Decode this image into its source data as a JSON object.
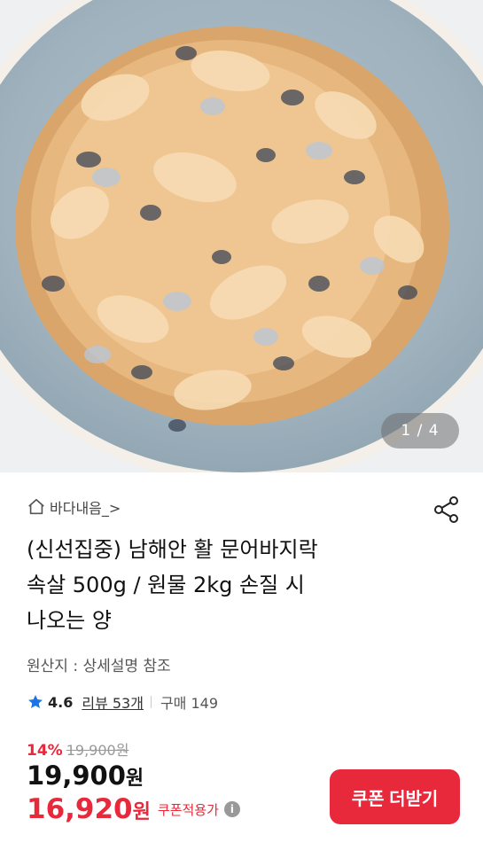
{
  "image": {
    "pager": "1 / 4",
    "icon": "product-photo-clams"
  },
  "store": {
    "name": "바다내음_>",
    "icon": "home-icon"
  },
  "product": {
    "title_lines": [
      "(신선집중) 남해안 활 문어바지락",
      "속살 500g / 원물 2kg 손질 시",
      "나오는 양"
    ],
    "origin": "원산지 : 상세설명 참조"
  },
  "rating": {
    "score": "4.6",
    "reviews": "리뷰 53개",
    "purchases": "구매 149"
  },
  "pricing": {
    "discount_pct": "14%",
    "original_price": "19,900원",
    "price": "19,900",
    "price_unit": "원",
    "coupon_price": "16,920",
    "coupon_unit": "원",
    "coupon_label": "쿠폰적용가"
  },
  "actions": {
    "coupon_button": "쿠폰 더받기",
    "share_icon": "share-icon"
  },
  "colors": {
    "accent": "#e8283b",
    "star": "#1a73e8"
  }
}
